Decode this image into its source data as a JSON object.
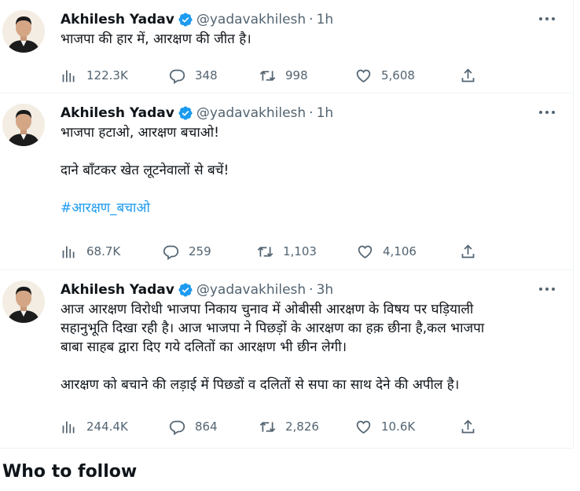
{
  "colors": {
    "text": "#0f1419",
    "secondary": "#536471",
    "accent": "#1d9bf0",
    "border": "#eff3f4"
  },
  "tweets": [
    {
      "author": "Akhilesh Yadav",
      "handle": "@yadavakhilesh",
      "separator": "·",
      "time": "1h",
      "lines": [
        "भाजपा की हार में, आरक्षण की जीत है।"
      ],
      "views": "122.3K",
      "replies": "348",
      "retweets": "998",
      "likes": "5,608"
    },
    {
      "author": "Akhilesh Yadav",
      "handle": "@yadavakhilesh",
      "separator": "·",
      "time": "1h",
      "lines": [
        "भाजपा हटाओ, आरक्षण बचाओ!",
        "दाने बाँटकर खेत लूटनेवालों से बचें!"
      ],
      "hashtag": "#आरक्षण_बचाओ",
      "views": "68.7K",
      "replies": "259",
      "retweets": "1,103",
      "likes": "4,106"
    },
    {
      "author": "Akhilesh Yadav",
      "handle": "@yadavakhilesh",
      "separator": "·",
      "time": "3h",
      "lines": [
        "आज आरक्षण विरोधी भाजपा निकाय चुनाव में ओबीसी आरक्षण के विषय पर घड़ियाली",
        "सहानुभूति दिखा रही है। आज भाजपा ने पिछड़ों के आरक्षण का हक़ छीना है,कल भाजपा",
        "बाबा साहब द्वारा दिए गये दलितों का आरक्षण भी छीन लेगी।",
        "आरक्षण को बचाने की लड़ाई में पिछडों व दलितों से सपा का साथ देने की अपील है।"
      ],
      "views": "244.4K",
      "replies": "864",
      "retweets": "2,826",
      "likes": "10.6K"
    }
  ],
  "who_to_follow": "Who to follow",
  "icons": {
    "verified": "verified-badge-icon",
    "more": "more-options-icon",
    "views": "analytics-icon",
    "reply": "reply-icon",
    "retweet": "retweet-icon",
    "like": "like-icon",
    "share": "share-icon"
  }
}
